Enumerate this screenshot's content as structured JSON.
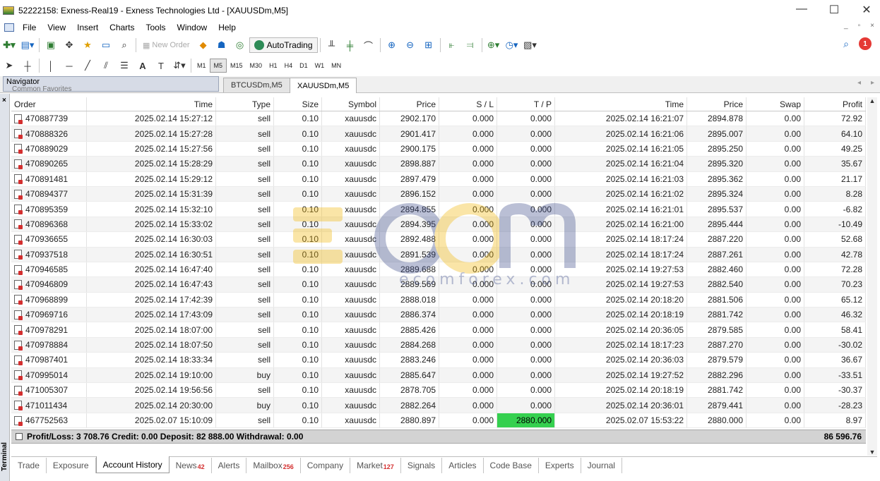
{
  "window": {
    "title": "52222158: Exness-Real19 - Exness Technologies Ltd - [XAUUSDm,M5]",
    "controls": [
      "—",
      "☐",
      "✕"
    ]
  },
  "menu": [
    "File",
    "View",
    "Insert",
    "Charts",
    "Tools",
    "Window",
    "Help"
  ],
  "toolbar": {
    "new_order": "New Order",
    "autotrading": "AutoTrading",
    "timeframes": [
      "M1",
      "M5",
      "M15",
      "M30",
      "H1",
      "H4",
      "D1",
      "W1",
      "MN"
    ],
    "active_timeframe": "M5",
    "notifications_badge": "1"
  },
  "navigator": {
    "title": "Navigator",
    "sub": "Common   Favorites"
  },
  "chart_tabs": [
    "BTCUSDm,M5",
    "XAUUSDm,M5"
  ],
  "terminal_label": "Terminal",
  "columns": [
    "Order",
    "Time",
    "Type",
    "Size",
    "Symbol",
    "Price",
    "S / L",
    "T / P",
    "Time",
    "Price",
    "Swap",
    "Profit"
  ],
  "rows": [
    [
      "470887739",
      "2025.02.14 15:27:12",
      "sell",
      "0.10",
      "xauusdc",
      "2902.170",
      "0.000",
      "0.000",
      "2025.02.14 16:21:07",
      "2894.878",
      "0.00",
      "72.92"
    ],
    [
      "470888326",
      "2025.02.14 15:27:28",
      "sell",
      "0.10",
      "xauusdc",
      "2901.417",
      "0.000",
      "0.000",
      "2025.02.14 16:21:06",
      "2895.007",
      "0.00",
      "64.10"
    ],
    [
      "470889029",
      "2025.02.14 15:27:56",
      "sell",
      "0.10",
      "xauusdc",
      "2900.175",
      "0.000",
      "0.000",
      "2025.02.14 16:21:05",
      "2895.250",
      "0.00",
      "49.25"
    ],
    [
      "470890265",
      "2025.02.14 15:28:29",
      "sell",
      "0.10",
      "xauusdc",
      "2898.887",
      "0.000",
      "0.000",
      "2025.02.14 16:21:04",
      "2895.320",
      "0.00",
      "35.67"
    ],
    [
      "470891481",
      "2025.02.14 15:29:12",
      "sell",
      "0.10",
      "xauusdc",
      "2897.479",
      "0.000",
      "0.000",
      "2025.02.14 16:21:03",
      "2895.362",
      "0.00",
      "21.17"
    ],
    [
      "470894377",
      "2025.02.14 15:31:39",
      "sell",
      "0.10",
      "xauusdc",
      "2896.152",
      "0.000",
      "0.000",
      "2025.02.14 16:21:02",
      "2895.324",
      "0.00",
      "8.28"
    ],
    [
      "470895359",
      "2025.02.14 15:32:10",
      "sell",
      "0.10",
      "xauusdc",
      "2894.855",
      "0.000",
      "0.000",
      "2025.02.14 16:21:01",
      "2895.537",
      "0.00",
      "-6.82"
    ],
    [
      "470896368",
      "2025.02.14 15:33:02",
      "sell",
      "0.10",
      "xauusdc",
      "2894.395",
      "0.000",
      "0.000",
      "2025.02.14 16:21:00",
      "2895.444",
      "0.00",
      "-10.49"
    ],
    [
      "470936655",
      "2025.02.14 16:30:03",
      "sell",
      "0.10",
      "xauusdc",
      "2892.488",
      "0.000",
      "0.000",
      "2025.02.14 18:17:24",
      "2887.220",
      "0.00",
      "52.68"
    ],
    [
      "470937518",
      "2025.02.14 16:30:51",
      "sell",
      "0.10",
      "xauusdc",
      "2891.539",
      "0.000",
      "0.000",
      "2025.02.14 18:17:24",
      "2887.261",
      "0.00",
      "42.78"
    ],
    [
      "470946585",
      "2025.02.14 16:47:40",
      "sell",
      "0.10",
      "xauusdc",
      "2889.688",
      "0.000",
      "0.000",
      "2025.02.14 19:27:53",
      "2882.460",
      "0.00",
      "72.28"
    ],
    [
      "470946809",
      "2025.02.14 16:47:43",
      "sell",
      "0.10",
      "xauusdc",
      "2889.569",
      "0.000",
      "0.000",
      "2025.02.14 19:27:53",
      "2882.540",
      "0.00",
      "70.23"
    ],
    [
      "470968899",
      "2025.02.14 17:42:39",
      "sell",
      "0.10",
      "xauusdc",
      "2888.018",
      "0.000",
      "0.000",
      "2025.02.14 20:18:20",
      "2881.506",
      "0.00",
      "65.12"
    ],
    [
      "470969716",
      "2025.02.14 17:43:09",
      "sell",
      "0.10",
      "xauusdc",
      "2886.374",
      "0.000",
      "0.000",
      "2025.02.14 20:18:19",
      "2881.742",
      "0.00",
      "46.32"
    ],
    [
      "470978291",
      "2025.02.14 18:07:00",
      "sell",
      "0.10",
      "xauusdc",
      "2885.426",
      "0.000",
      "0.000",
      "2025.02.14 20:36:05",
      "2879.585",
      "0.00",
      "58.41"
    ],
    [
      "470978884",
      "2025.02.14 18:07:50",
      "sell",
      "0.10",
      "xauusdc",
      "2884.268",
      "0.000",
      "0.000",
      "2025.02.14 18:17:23",
      "2887.270",
      "0.00",
      "-30.02"
    ],
    [
      "470987401",
      "2025.02.14 18:33:34",
      "sell",
      "0.10",
      "xauusdc",
      "2883.246",
      "0.000",
      "0.000",
      "2025.02.14 20:36:03",
      "2879.579",
      "0.00",
      "36.67"
    ],
    [
      "470995014",
      "2025.02.14 19:10:00",
      "buy",
      "0.10",
      "xauusdc",
      "2885.647",
      "0.000",
      "0.000",
      "2025.02.14 19:27:52",
      "2882.296",
      "0.00",
      "-33.51"
    ],
    [
      "471005307",
      "2025.02.14 19:56:56",
      "sell",
      "0.10",
      "xauusdc",
      "2878.705",
      "0.000",
      "0.000",
      "2025.02.14 20:18:19",
      "2881.742",
      "0.00",
      "-30.37"
    ],
    [
      "471011434",
      "2025.02.14 20:30:00",
      "buy",
      "0.10",
      "xauusdc",
      "2882.264",
      "0.000",
      "0.000",
      "2025.02.14 20:36:01",
      "2879.441",
      "0.00",
      "-28.23"
    ],
    [
      "467752563",
      "2025.02.07 15:10:09",
      "sell",
      "0.10",
      "xauusdc",
      "2880.897",
      "0.000",
      "2880.000",
      "2025.02.07 15:53:22",
      "2880.000",
      "0.00",
      "8.97"
    ]
  ],
  "tp_highlight_color": "#35d04f",
  "summary": {
    "text": "Profit/Loss: 3 708.76  Credit: 0.00  Deposit: 82 888.00  Withdrawal: 0.00",
    "total": "86 596.76"
  },
  "bottom_tabs": [
    {
      "label": "Trade",
      "count": ""
    },
    {
      "label": "Exposure",
      "count": ""
    },
    {
      "label": "Account History",
      "count": "",
      "active": true
    },
    {
      "label": "News",
      "count": "42"
    },
    {
      "label": "Alerts",
      "count": ""
    },
    {
      "label": "Mailbox",
      "count": "256"
    },
    {
      "label": "Company",
      "count": ""
    },
    {
      "label": "Market",
      "count": "127"
    },
    {
      "label": "Signals",
      "count": ""
    },
    {
      "label": "Articles",
      "count": ""
    },
    {
      "label": "Code Base",
      "count": ""
    },
    {
      "label": "Experts",
      "count": ""
    },
    {
      "label": "Journal",
      "count": ""
    }
  ],
  "watermark": "ecomforex.com"
}
